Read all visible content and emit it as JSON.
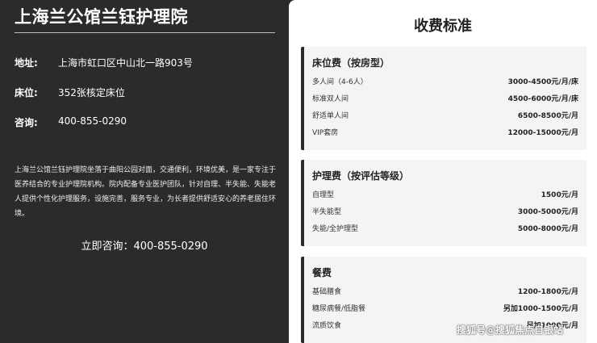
{
  "left": {
    "title": "上海兰公馆兰钰护理院",
    "info": [
      {
        "key": "地址:",
        "value": "上海市虹口区中山北一路903号"
      },
      {
        "key": "床位:",
        "value": "352张核定床位"
      },
      {
        "key": "咨询:",
        "value": "400-855-0290"
      }
    ],
    "description": "上海兰公馆兰钰护理院坐落于曲阳公园对面，交通便利，环境优美，是一家专注于医养结合的专业护理院机构。院内配备专业医护团队，针对自理、半失能、失能老人提供个性化护理服务，设施完善，服务专业，为长者提供舒适安心的养老居住环境。",
    "cta": "立即咨询：400-855-0290"
  },
  "right": {
    "title": "收费标准",
    "cards": [
      {
        "title": "床位费（按房型）",
        "rows": [
          {
            "name": "多人间（4-6人）",
            "price": "3000-4500元/月/床"
          },
          {
            "name": "标准双人间",
            "price": "4500-6000元/月/床"
          },
          {
            "name": "舒适单人间",
            "price": "6500-8500元/月"
          },
          {
            "name": "VIP套房",
            "price": "12000-15000元/月"
          }
        ]
      },
      {
        "title": "护理费（按评估等级）",
        "rows": [
          {
            "name": "自理型",
            "price": "1500元/月"
          },
          {
            "name": "半失能型",
            "price": "3000-5000元/月"
          },
          {
            "name": "失能/全护理型",
            "price": "5000-8000元/月"
          }
        ]
      },
      {
        "title": "餐费",
        "rows": [
          {
            "name": "基础膳食",
            "price": "1200-1800元/月"
          },
          {
            "name": "糖尿病餐/低脂餐",
            "price": "另加1000-1500元/月"
          },
          {
            "name": "流质饮食",
            "price": "另加1000元/月"
          }
        ]
      }
    ]
  },
  "watermark": "搜狐号@搜狐焦点自银站"
}
